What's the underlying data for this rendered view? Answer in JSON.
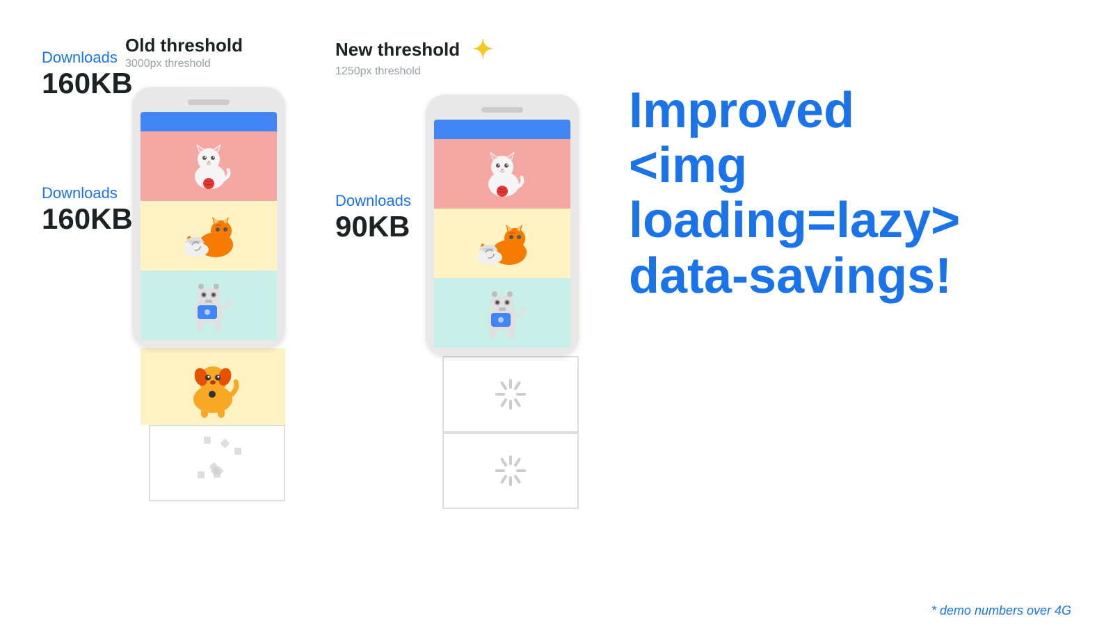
{
  "page": {
    "background": "#ffffff"
  },
  "left_column": {
    "threshold_title": "Old threshold",
    "threshold_sub": "3000px threshold",
    "downloads_label": "Downloads",
    "downloads_size": "160KB"
  },
  "right_column": {
    "threshold_title": "New threshold",
    "threshold_sub": "1250px threshold",
    "downloads_label": "Downloads",
    "downloads_size": "90KB"
  },
  "headline": {
    "line1": "Improved",
    "line2": "<img loading=lazy>",
    "line3": "data-savings!"
  },
  "footnote": "* demo numbers over 4G"
}
